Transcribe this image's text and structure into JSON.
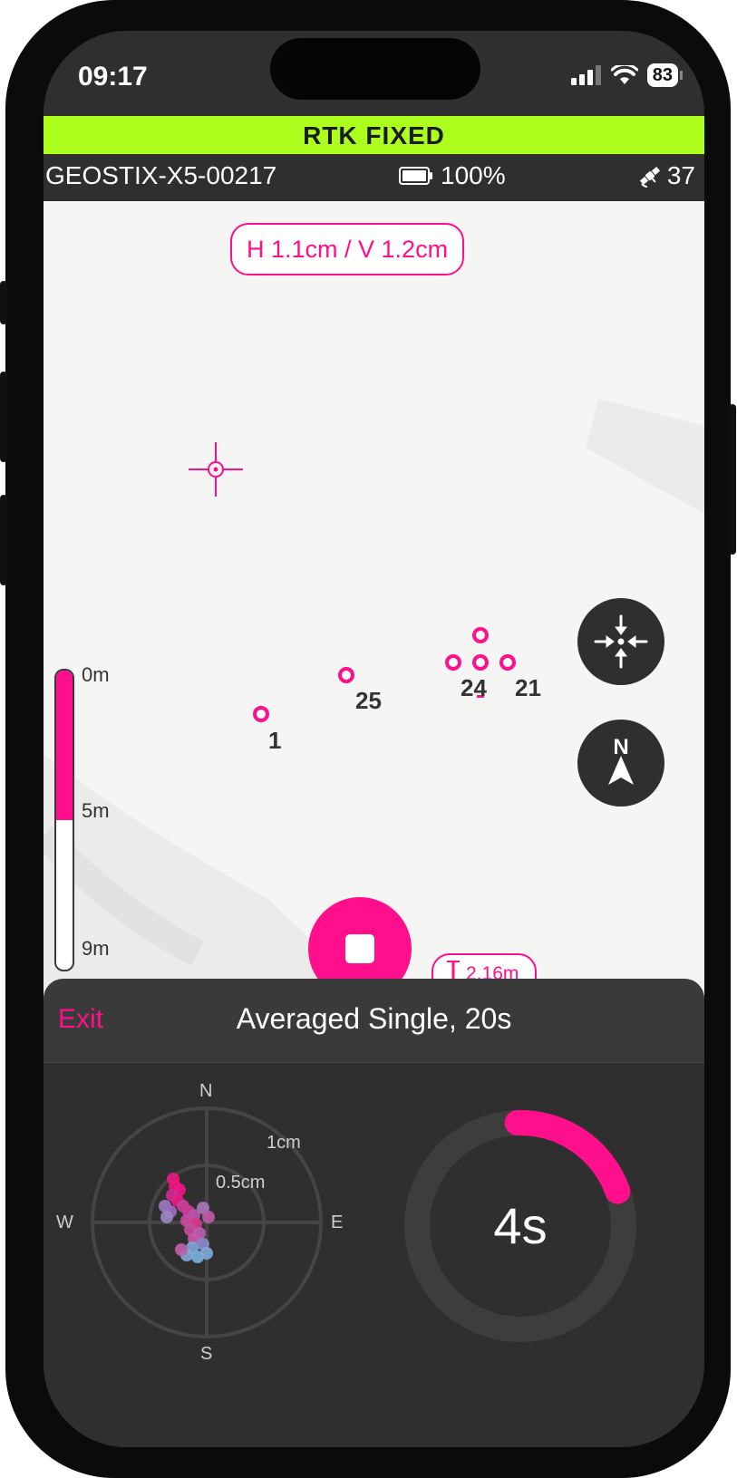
{
  "status_bar": {
    "time": "09:17",
    "battery": "83"
  },
  "rtk_status": "RTK FIXED",
  "device": {
    "id": "GEOSTIX-X5-00217",
    "battery": "100%",
    "satellites": "37"
  },
  "map": {
    "accuracy": "H 1.1cm / V 1.2cm",
    "points": [
      {
        "label": "1"
      },
      {
        "label": "25"
      },
      {
        "label": "24"
      },
      {
        "label": "21"
      }
    ],
    "depth_scale": {
      "labels": [
        "0m",
        "5m",
        "9m"
      ],
      "fill_fraction": 0.5
    },
    "height_readout": "2.16m",
    "controls": {
      "center_icon": "converge-arrows-icon",
      "north_icon": "north-arrow-icon",
      "north_label": "N"
    }
  },
  "panel": {
    "exit_label": "Exit",
    "mode_title": "Averaged Single, 20s",
    "scatter": {
      "directions": {
        "n": "N",
        "s": "S",
        "e": "E",
        "w": "W"
      },
      "rings": [
        "1cm",
        "0.5cm"
      ]
    },
    "timer": {
      "remaining": "4s",
      "progress_fraction": 0.2
    }
  },
  "colors": {
    "accent": "#ff0f8c",
    "rtk_green": "#adff1e",
    "dark": "#2f2f2f"
  }
}
